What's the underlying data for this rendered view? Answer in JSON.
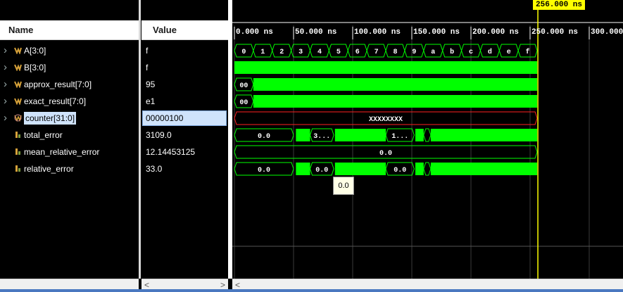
{
  "columns": {
    "name": "Name",
    "value": "Value"
  },
  "signals": [
    {
      "name": "A[3:0]",
      "value": "f",
      "icon": "bus-icon",
      "expandable": true
    },
    {
      "name": "B[3:0]",
      "value": "f",
      "icon": "bus-icon",
      "expandable": true
    },
    {
      "name": "approx_result[7:0]",
      "value": "95",
      "icon": "bus-icon",
      "expandable": true
    },
    {
      "name": "exact_result[7:0]",
      "value": "e1",
      "icon": "bus-icon",
      "expandable": true
    },
    {
      "name": "counter[31:0]",
      "value": "00000100",
      "icon": "bus-icon",
      "expandable": true,
      "selected": true
    },
    {
      "name": "total_error",
      "value": "3109.0",
      "icon": "real-signal-icon",
      "expandable": false
    },
    {
      "name": "mean_relative_error",
      "value": "12.14453125",
      "icon": "real-signal-icon",
      "expandable": false
    },
    {
      "name": "relative_error",
      "value": "33.0",
      "icon": "real-signal-icon",
      "expandable": false
    }
  ],
  "cursor": {
    "label": "256.000 ns",
    "time_ns": 256
  },
  "time_axis": {
    "ticks": [
      "0.000 ns",
      "50.000 ns",
      "100.000 ns",
      "150.000 ns",
      "200.000 ns",
      "250.000 ns",
      "300.000"
    ]
  },
  "waves": {
    "a_values": [
      "0",
      "1",
      "2",
      "3",
      "4",
      "5",
      "6",
      "7",
      "8",
      "9",
      "a",
      "b",
      "c",
      "d",
      "e",
      "f"
    ],
    "approx_label": "00",
    "exact_label": "00",
    "counter_label": "XXXXXXXX",
    "total_error_labels": [
      "0.0",
      "3...",
      "1..."
    ],
    "mean_relative_label": "0.0",
    "relative_error_labels": [
      "0.0",
      "0.0",
      "0.0"
    ]
  },
  "tooltip": "0.0",
  "scroll": {
    "left_arrow": "<",
    "right_arrow": ">"
  },
  "colors": {
    "wave_green": "#00ff00",
    "counter_red": "#ff2020",
    "cursor_yellow": "#ffff00",
    "grid": "#3a3a3a"
  }
}
